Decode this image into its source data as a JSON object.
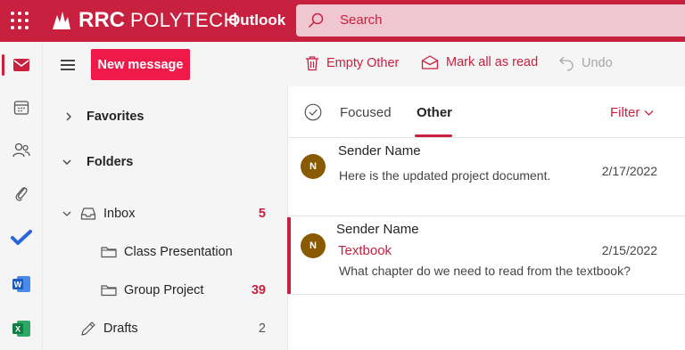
{
  "header": {
    "brand_rrc": "RRC",
    "brand_poly": "POLYTECH",
    "app_name": "Outlook",
    "search_placeholder": "Search"
  },
  "rail": {
    "items": [
      "mail-icon",
      "calendar-icon",
      "people-icon",
      "attach-icon",
      "todo-icon",
      "word-icon",
      "excel-icon"
    ]
  },
  "folder_pane": {
    "new_message_label": "New message",
    "favorites_label": "Favorites",
    "folders_label": "Folders",
    "items": [
      {
        "label": "Inbox",
        "count": "5"
      },
      {
        "label": "Class Presentation",
        "count": ""
      },
      {
        "label": "Group Project",
        "count": "39"
      },
      {
        "label": "Drafts",
        "count": "2"
      }
    ]
  },
  "command_bar": {
    "empty_label": "Empty Other",
    "mark_read_label": "Mark all as read",
    "undo_label": "Undo"
  },
  "message_list": {
    "tabs": {
      "focused": "Focused",
      "other": "Other"
    },
    "filter_label": "Filter",
    "messages": [
      {
        "initial": "N",
        "sender": "Sender Name",
        "subject": "",
        "preview": "Here is the updated project document.",
        "date": "2/17/2022"
      },
      {
        "initial": "N",
        "sender": "Sender Name",
        "subject": "Textbook",
        "preview": "What chapter do we need to read from the textbook?",
        "date": "2/15/2022"
      }
    ]
  },
  "colors": {
    "brand": "#c8203f",
    "new_message_button": "#ef1a4a",
    "avatar": "#8a5a00"
  }
}
